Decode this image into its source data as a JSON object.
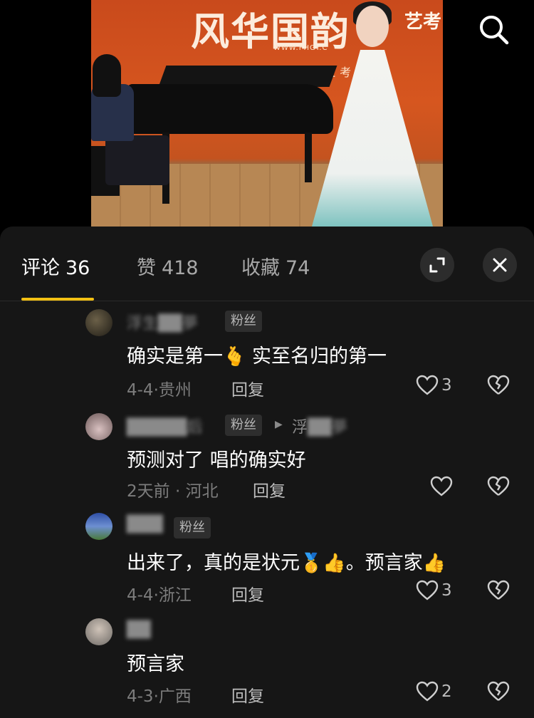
{
  "video": {
    "banner_title": "风华国韵",
    "banner_sub": "艺考",
    "banner_url": "WWW.FHGY.C",
    "banner_slogan": "精于考 止考学"
  },
  "tabs": [
    {
      "label": "评论",
      "count": "36"
    },
    {
      "label": "赞",
      "count": "418"
    },
    {
      "label": "收藏",
      "count": "74"
    }
  ],
  "fan_badge": "粉丝",
  "reply_label": "回复",
  "comments": [
    {
      "username": "浮生██夢",
      "text_a": "确实是第一",
      "emoji_a": "🫰",
      "text_b": " 实至名归的第一",
      "date": "4-4",
      "location": "贵州",
      "likes": "3"
    },
    {
      "username": "█████后",
      "reply_to_a": "浮",
      "reply_to_b": "██夢",
      "text_a": "预测对了 唱的确实好",
      "date": "2天前",
      "location": "河北",
      "likes": ""
    },
    {
      "username": "███",
      "text_a": "出来了，真的是状元",
      "emoji_a": "🥇👍",
      "text_b": "。预言家",
      "emoji_b": "👍",
      "date": "4-4",
      "location": "浙江",
      "likes": "3"
    },
    {
      "username": "██",
      "text_a": "预言家",
      "date": "4-3",
      "location": "广西",
      "likes": "2"
    }
  ]
}
